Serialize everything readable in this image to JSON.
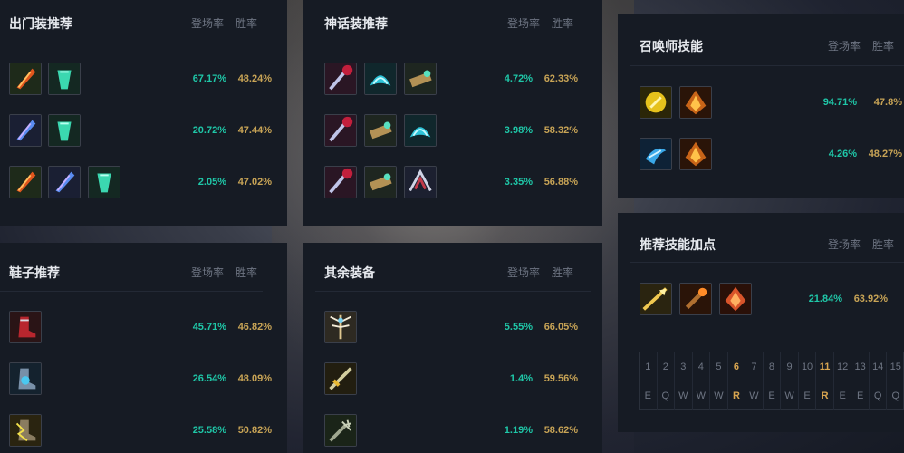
{
  "panels": {
    "starter": {
      "title": "出门装推荐",
      "col_pick": "登场率",
      "col_win": "胜率",
      "rows": [
        {
          "icons": [
            "fire-dagger-icon",
            "green-potion-icon"
          ],
          "pick": "67.17%",
          "win": "48.24%"
        },
        {
          "icons": [
            "blue-dagger-icon",
            "green-potion-icon"
          ],
          "pick": "20.72%",
          "win": "47.44%"
        },
        {
          "icons": [
            "fire-dagger-icon",
            "blue-dagger-icon",
            "green-potion-icon"
          ],
          "pick": "2.05%",
          "win": "47.02%"
        }
      ]
    },
    "mythic": {
      "title": "神话装推荐",
      "col_pick": "登场率",
      "col_win": "胜率",
      "rows": [
        {
          "icons": [
            "crimson-blade-icon",
            "teal-shield-icon",
            "brass-cannon-icon"
          ],
          "pick": "4.72%",
          "win": "62.33%"
        },
        {
          "icons": [
            "crimson-blade-icon",
            "brass-cannon-icon",
            "teal-shield-icon"
          ],
          "pick": "3.98%",
          "win": "58.32%"
        },
        {
          "icons": [
            "crimson-blade-icon",
            "brass-cannon-icon",
            "silver-claw-icon"
          ],
          "pick": "3.35%",
          "win": "56.88%"
        }
      ]
    },
    "summoner": {
      "title": "召唤师技能",
      "col_pick": "登场率",
      "col_win": "胜率",
      "rows": [
        {
          "icons": [
            "flash-icon",
            "ignite-icon"
          ],
          "pick": "94.71%",
          "win": "47.8%"
        },
        {
          "icons": [
            "ghost-icon",
            "ignite-icon"
          ],
          "pick": "4.26%",
          "win": "48.27%"
        }
      ]
    },
    "boots": {
      "title": "鞋子推荐",
      "col_pick": "登场率",
      "col_win": "胜率",
      "rows": [
        {
          "icons": [
            "red-boots-icon"
          ],
          "pick": "45.71%",
          "win": "46.82%"
        },
        {
          "icons": [
            "steel-boots-icon"
          ],
          "pick": "26.54%",
          "win": "48.09%"
        },
        {
          "icons": [
            "gold-boots-icon"
          ],
          "pick": "25.58%",
          "win": "50.82%"
        }
      ]
    },
    "others": {
      "title": "其余装备",
      "col_pick": "登场率",
      "col_win": "胜率",
      "rows": [
        {
          "icons": [
            "winged-staff-icon"
          ],
          "pick": "5.55%",
          "win": "66.05%"
        },
        {
          "icons": [
            "golden-sword-icon"
          ],
          "pick": "1.4%",
          "win": "59.56%"
        },
        {
          "icons": [
            "spiked-mace-icon"
          ],
          "pick": "1.19%",
          "win": "58.62%"
        }
      ]
    },
    "skills": {
      "title": "推荐技能加点",
      "col_pick": "登场率",
      "col_win": "胜率",
      "rows": [
        {
          "icons": [
            "spear-q-icon",
            "flame-w-icon",
            "fire-e-icon"
          ],
          "pick": "21.84%",
          "win": "63.92%"
        }
      ],
      "levels": [
        "1",
        "2",
        "3",
        "4",
        "5",
        "6",
        "7",
        "8",
        "9",
        "10",
        "11",
        "12",
        "13",
        "14",
        "15"
      ],
      "order": [
        "E",
        "Q",
        "W",
        "W",
        "W",
        "R",
        "W",
        "E",
        "W",
        "E",
        "R",
        "E",
        "E",
        "Q",
        "Q"
      ],
      "highlight_levels": [
        "6",
        "11"
      ]
    }
  }
}
